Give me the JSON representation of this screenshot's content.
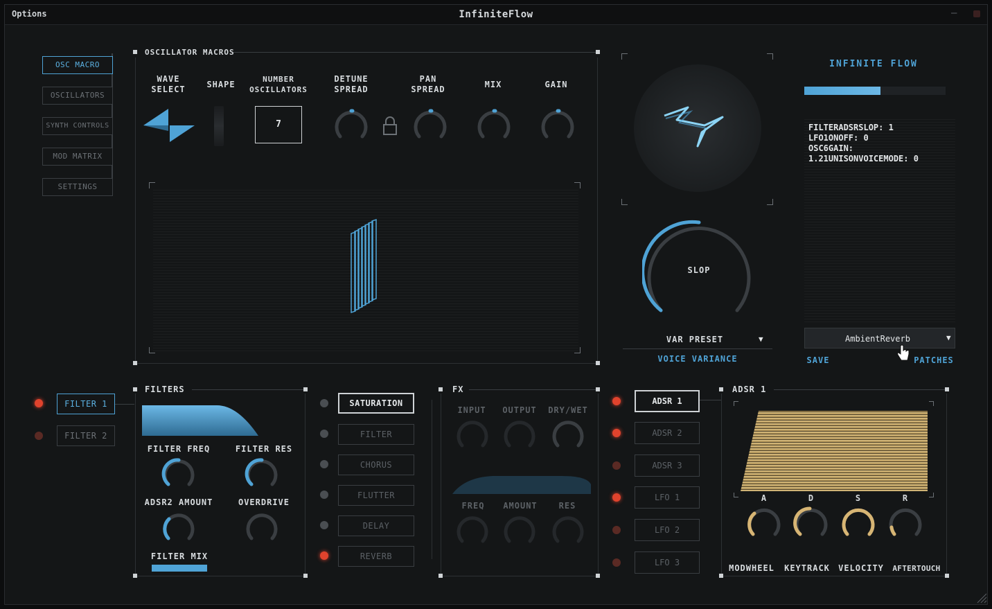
{
  "window": {
    "menu": "Options",
    "title": "InfiniteFlow"
  },
  "nav": {
    "items": [
      {
        "label": "OSC MACRO",
        "active": true
      },
      {
        "label": "OSCILLATORS",
        "active": false
      },
      {
        "label": "SYNTH CONTROLS",
        "active": false
      },
      {
        "label": "MOD MATRIX",
        "active": false
      },
      {
        "label": "SETTINGS",
        "active": false
      }
    ]
  },
  "osc_macros": {
    "title": "OSCILLATOR MACROS",
    "wave_select": "WAVE\nSELECT",
    "shape": "SHAPE",
    "number_osc": "NUMBER\nOSCILLATORS",
    "number_value": "7",
    "detune": "DETUNE\nSPREAD",
    "pan": "PAN\nSPREAD",
    "mix": "MIX",
    "gain": "GAIN"
  },
  "right_panel": {
    "brand": "INFINITE FLOW",
    "info_lines": [
      "FILTERADSRSLOP: 1",
      "LFO1ONOFF: 0",
      "OSC6GAIN:",
      "1.21UNISONVOICEMODE: 0"
    ],
    "slop": "SLOP",
    "var_preset": "VAR PRESET",
    "voice_variance": "VOICE VARIANCE",
    "patch": "AmbientReverb",
    "save": "SAVE",
    "patches": "PATCHES"
  },
  "filters": {
    "title": "FILTERS",
    "items": [
      {
        "label": "FILTER 1",
        "active": true
      },
      {
        "label": "FILTER 2",
        "active": false
      }
    ],
    "filter_freq": "FILTER FREQ",
    "filter_res": "FILTER RES",
    "adsr2_amount": "ADSR2 AMOUNT",
    "overdrive": "OVERDRIVE",
    "filter_mix": "FILTER MIX"
  },
  "fx_list": {
    "items": [
      {
        "label": "SATURATION",
        "active": true
      },
      {
        "label": "FILTER",
        "active": false
      },
      {
        "label": "CHORUS",
        "active": false
      },
      {
        "label": "FLUTTER",
        "active": false
      },
      {
        "label": "DELAY",
        "active": false
      },
      {
        "label": "REVERB",
        "active": false
      }
    ]
  },
  "fx": {
    "title": "FX",
    "input": "INPUT",
    "output": "OUTPUT",
    "drywet": "DRY/WET",
    "freq": "FREQ",
    "amount": "AMOUNT",
    "res": "RES"
  },
  "adsr_list": {
    "items": [
      {
        "label": "ADSR 1",
        "active": true
      },
      {
        "label": "ADSR 2",
        "active": false
      },
      {
        "label": "ADSR 3",
        "active": false
      },
      {
        "label": "LFO 1",
        "active": false
      },
      {
        "label": "LFO 2",
        "active": false
      },
      {
        "label": "LFO 3",
        "active": false
      }
    ]
  },
  "adsr": {
    "title": "ADSR 1",
    "a": "A",
    "d": "D",
    "s": "S",
    "r": "R",
    "modwheel": "MODWHEEL",
    "keytrack": "KEYTRACK",
    "velocity": "VELOCITY",
    "aftertouch": "AFTERTOUCH"
  },
  "colors": {
    "accent": "#4fa3d6",
    "led": "#e0432d",
    "gold": "#d7b574"
  }
}
